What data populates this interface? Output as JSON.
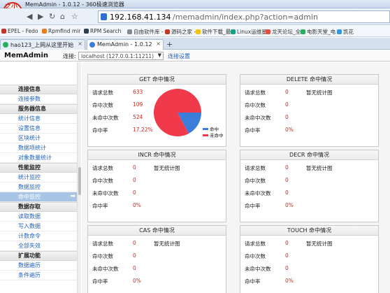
{
  "browser": {
    "title": "MemAdmin - 1.0.12 - 360极速浏览器",
    "logo_line1": "之小",
    "logo_line2": "印象",
    "url_host": "192.168.41.134",
    "url_path": "/memadmin/index.php?action=admin",
    "nav": {
      "back": "◀",
      "forward": "▶",
      "refresh": "↻",
      "home": "⌂",
      "bookmark": "☆"
    },
    "bookmarks": [
      {
        "label": "EPEL - Fedo",
        "color": "#c0392b"
      },
      {
        "label": "Rpmfind mir",
        "color": "#e67e22"
      },
      {
        "label": "RPM Search",
        "color": "#2c3e50"
      },
      {
        "label": "自由软件库 -",
        "color": "#7f8c8d"
      },
      {
        "label": "源码之家 -",
        "color": "#c0392b"
      },
      {
        "label": "软件下载_最",
        "color": "#f1c40f"
      },
      {
        "label": "Linux运维星",
        "color": "#16a085"
      },
      {
        "label": "龙天论坛_全",
        "color": "#e74c3c"
      },
      {
        "label": "电影天堂_电",
        "color": "#27ae60"
      },
      {
        "label": "凯花",
        "color": "#3498db"
      }
    ],
    "tabs": [
      {
        "label": "hao123_上网从这里开始",
        "fav_color": "#27ae60",
        "close": "×"
      },
      {
        "label": "MemAdmin - 1.0.12",
        "fav_color": "#3b7dd8",
        "close": "×"
      }
    ],
    "new_tab": "+"
  },
  "header": {
    "brand": "MemAdmin",
    "connect_label": "连接:",
    "connection_value": "localhost (127.0.0.1:11211)",
    "dropdown_arrow": "▼",
    "settings_link": "连接设置"
  },
  "sidebar": {
    "sections": [
      {
        "title": "连接信息",
        "items": [
          {
            "label": "连接参数",
            "active": false
          }
        ]
      },
      {
        "title": "服务器信息",
        "items": [
          {
            "label": "统计信息",
            "active": false
          },
          {
            "label": "设置信息",
            "active": false
          },
          {
            "label": "区块统计",
            "active": false
          },
          {
            "label": "数据项统计",
            "active": false
          },
          {
            "label": "对象数量统计",
            "active": false
          }
        ]
      },
      {
        "title": "性能监控",
        "items": [
          {
            "label": "统计监控",
            "active": false
          },
          {
            "label": "数据监控",
            "active": false
          },
          {
            "label": "命中监控",
            "active": true
          }
        ]
      },
      {
        "title": "数据存取",
        "items": [
          {
            "label": "读取数据",
            "active": false
          },
          {
            "label": "写入数据",
            "active": false
          },
          {
            "label": "计数命令",
            "active": false
          },
          {
            "label": "全部失效",
            "active": false
          }
        ]
      },
      {
        "title": "扩展功能",
        "items": [
          {
            "label": "数据遍历",
            "active": false
          },
          {
            "label": "条件遍历",
            "active": false
          }
        ]
      }
    ],
    "active_arrow": "➡"
  },
  "panels": [
    {
      "title": "GET 命中情况",
      "rows": [
        {
          "k": "请求总数",
          "v": "633"
        },
        {
          "k": "命中次数",
          "v": "109"
        },
        {
          "k": "未命中次数",
          "v": "524"
        },
        {
          "k": "命中率",
          "v": "17.22%"
        }
      ],
      "has_chart": true,
      "no_chart_text": ""
    },
    {
      "title": "DELETE 命中情况",
      "rows": [
        {
          "k": "请求总数",
          "v": "0"
        },
        {
          "k": "命中次数",
          "v": "0"
        },
        {
          "k": "未命中次数",
          "v": "0"
        },
        {
          "k": "命中率",
          "v": "0%"
        }
      ],
      "has_chart": false,
      "no_chart_text": "暂无统计图"
    },
    {
      "title": "INCR 命中情况",
      "rows": [
        {
          "k": "请求总数",
          "v": "0"
        },
        {
          "k": "命中次数",
          "v": "0"
        },
        {
          "k": "未命中次数",
          "v": "0"
        },
        {
          "k": "命中率",
          "v": "0%"
        }
      ],
      "has_chart": false,
      "no_chart_text": "暂无统计图"
    },
    {
      "title": "DECR 命中情况",
      "rows": [
        {
          "k": "请求总数",
          "v": "0"
        },
        {
          "k": "命中次数",
          "v": "0"
        },
        {
          "k": "未命中次数",
          "v": "0"
        },
        {
          "k": "命中率",
          "v": "0%"
        }
      ],
      "has_chart": false,
      "no_chart_text": "暂无统计图"
    },
    {
      "title": "CAS 命中情况",
      "rows": [
        {
          "k": "请求总数",
          "v": "0"
        },
        {
          "k": "命中次数",
          "v": "0"
        },
        {
          "k": "未命中次数",
          "v": "0"
        },
        {
          "k": "命中率",
          "v": "0%"
        }
      ],
      "has_chart": false,
      "no_chart_text": "暂无统计图"
    },
    {
      "title": "TOUCH 命中情况",
      "rows": [
        {
          "k": "请求总数",
          "v": "0"
        },
        {
          "k": "命中次数",
          "v": "0"
        },
        {
          "k": "未命中次数",
          "v": "0"
        },
        {
          "k": "命中率",
          "v": "0%"
        }
      ],
      "has_chart": false,
      "no_chart_text": "暂无统计图"
    }
  ],
  "chart_data": {
    "type": "pie",
    "categories": [
      "命中",
      "未命中"
    ],
    "values": [
      109,
      524
    ],
    "colors": [
      "#3b7dd8",
      "#f0394a"
    ],
    "legend_position": "right"
  }
}
